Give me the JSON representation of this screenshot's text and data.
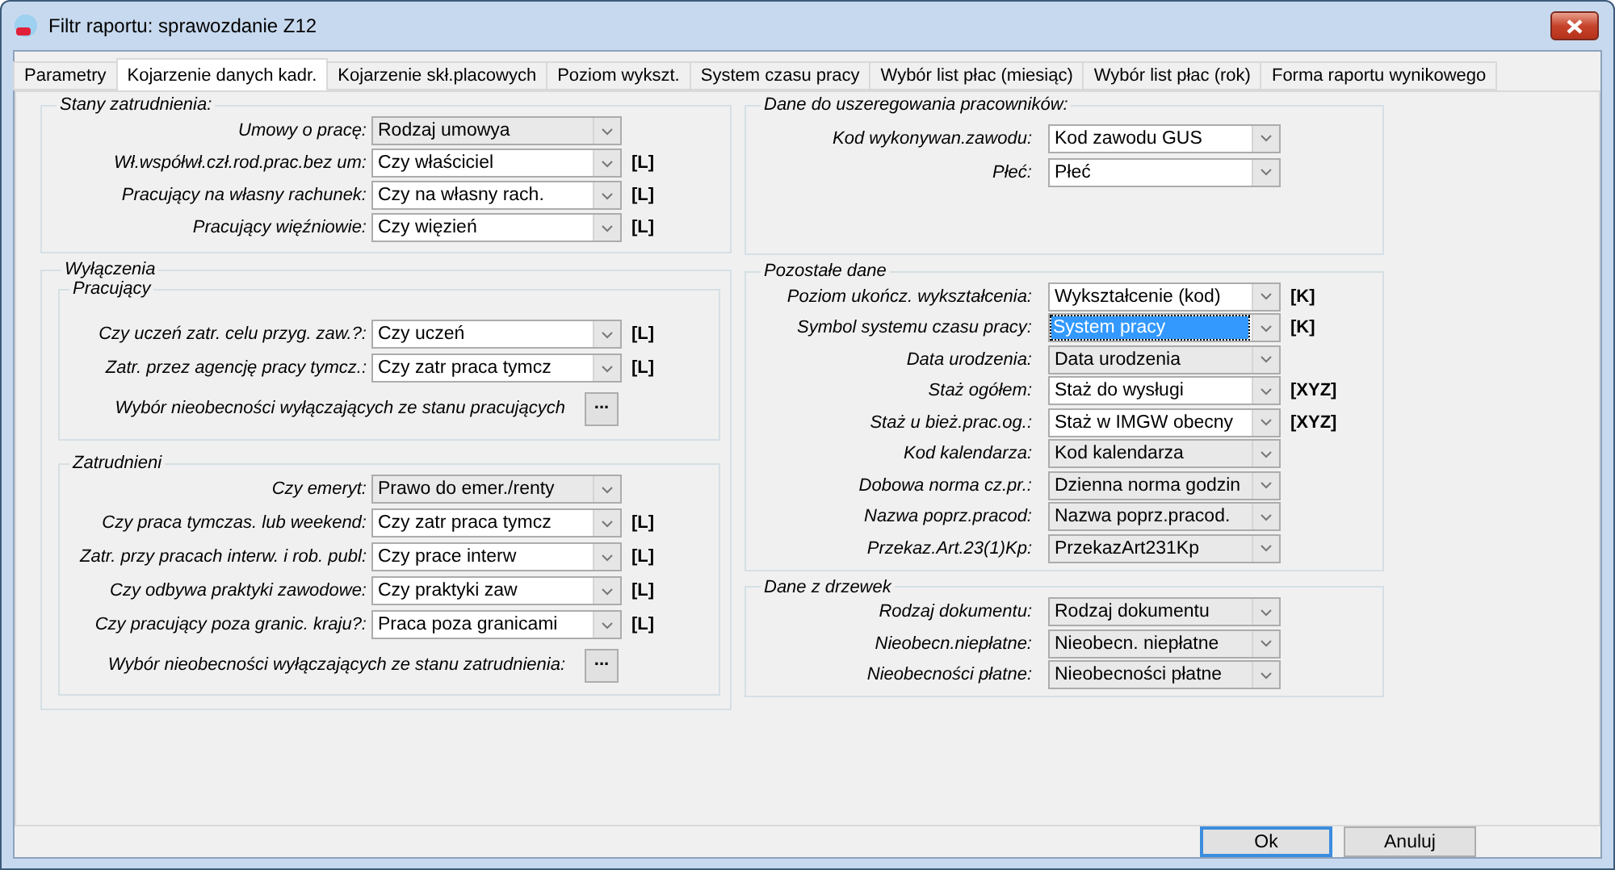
{
  "window": {
    "title": "Filtr raportu: sprawozdanie Z12"
  },
  "tabs": [
    {
      "label": "Parametry",
      "selected": false
    },
    {
      "label": "Kojarzenie danych kadr.",
      "selected": true
    },
    {
      "label": "Kojarzenie skł.placowych",
      "selected": false
    },
    {
      "label": "Poziom wykszt.",
      "selected": false
    },
    {
      "label": "System czasu pracy",
      "selected": false
    },
    {
      "label": "Wybór list płac (miesiąc)",
      "selected": false
    },
    {
      "label": "Wybór list płac (rok)",
      "selected": false
    },
    {
      "label": "Forma raportu wynikowego",
      "selected": false
    }
  ],
  "left_groups": [
    {
      "title": "Stany zatrudnienia:",
      "rows": [
        {
          "kind": "combo",
          "label": "Umowy o pracę:",
          "value": "Rodzaj umowya",
          "disabled": true
        },
        {
          "kind": "combo",
          "label": "Wł.współwł.czł.rod.prac.bez um:",
          "value": "Czy właściciel",
          "disabled": false,
          "tag": "[L]"
        },
        {
          "kind": "combo",
          "label": "Pracujący na własny rachunek:",
          "value": "Czy na własny rach.",
          "disabled": false,
          "tag": "[L]"
        },
        {
          "kind": "combo",
          "label": "Pracujący więźniowie:",
          "value": "Czy więzień",
          "disabled": false,
          "tag": "[L]"
        }
      ]
    },
    {
      "title": "Wyłączenia",
      "subgroups": [
        {
          "title": "Pracujący",
          "rows": [
            {
              "kind": "combo",
              "label": "Czy uczeń zatr. celu przyg. zaw.?:",
              "value": "Czy uczeń",
              "disabled": false,
              "tag": "[L]"
            },
            {
              "kind": "combo",
              "label": "Zatr. przez agencję pracy tymcz.:",
              "value": "Czy zatr praca tymcz",
              "disabled": false,
              "tag": "[L]"
            },
            {
              "kind": "button",
              "label": "Wybór nieobecności wyłączających ze stanu pracujących",
              "button": "..."
            }
          ]
        },
        {
          "title": "Zatrudnieni",
          "rows": [
            {
              "kind": "combo",
              "label": "Czy emeryt:",
              "value": "Prawo do emer./renty",
              "disabled": true
            },
            {
              "kind": "combo",
              "label": "Czy praca tymczas. lub weekend:",
              "value": "Czy zatr praca tymcz",
              "disabled": false,
              "tag": "[L]"
            },
            {
              "kind": "combo",
              "label": "Zatr. przy pracach interw. i rob. publ:",
              "value": "Czy prace interw",
              "disabled": false,
              "tag": "[L]"
            },
            {
              "kind": "combo",
              "label": "Czy odbywa praktyki zawodowe:",
              "value": "Czy praktyki zaw",
              "disabled": false,
              "tag": "[L]"
            },
            {
              "kind": "combo",
              "label": "Czy pracujący poza granic. kraju?:",
              "value": "Praca poza granicami",
              "disabled": false,
              "tag": "[L]"
            },
            {
              "kind": "button",
              "label": "Wybór nieobecności wyłączających ze stanu zatrudnienia:",
              "button": "..."
            }
          ]
        }
      ]
    }
  ],
  "right_groups": [
    {
      "title": "Dane do uszeregowania pracowników:",
      "rows": [
        {
          "kind": "combo",
          "label": "Kod wykonywan.zawodu:",
          "value": "Kod zawodu GUS",
          "disabled": false
        },
        {
          "kind": "combo",
          "label": "Płeć:",
          "value": "Płeć",
          "disabled": false
        }
      ]
    },
    {
      "title": "Pozostałe dane",
      "rows": [
        {
          "kind": "combo",
          "label": "Poziom ukończ. wykształcenia:",
          "value": "Wykształcenie (kod)",
          "disabled": false,
          "tag": "[K]"
        },
        {
          "kind": "combo",
          "label": "Symbol systemu czasu pracy:",
          "value": "System pracy",
          "disabled": false,
          "focused": true,
          "tag": "[K]"
        },
        {
          "kind": "combo",
          "label": "Data urodzenia:",
          "value": "Data urodzenia",
          "disabled": true
        },
        {
          "kind": "combo",
          "label": "Staż ogółem:",
          "value": "Staż do wysługi",
          "disabled": false,
          "tag": "[XYZ]"
        },
        {
          "kind": "combo",
          "label": "Staż u bież.prac.og.:",
          "value": "Staż w IMGW obecny",
          "disabled": false,
          "tag": "[XYZ]"
        },
        {
          "kind": "combo",
          "label": "Kod kalendarza:",
          "value": "Kod kalendarza",
          "disabled": true
        },
        {
          "kind": "combo",
          "label": "Dobowa norma cz.pr.:",
          "value": "Dzienna norma godzin",
          "disabled": true
        },
        {
          "kind": "combo",
          "label": "Nazwa poprz.pracod:",
          "value": "Nazwa poprz.pracod.",
          "disabled": true
        },
        {
          "kind": "combo",
          "label": "Przekaz.Art.23(1)Kp:",
          "value": "PrzekazArt231Kp",
          "disabled": true
        }
      ]
    },
    {
      "title": "Dane z drzewek",
      "rows": [
        {
          "kind": "combo",
          "label": "Rodzaj dokumentu:",
          "value": "Rodzaj dokumentu",
          "disabled": true
        },
        {
          "kind": "combo",
          "label": "Nieobecn.niepłatne:",
          "value": "Nieobecn. niepłatne",
          "disabled": true
        },
        {
          "kind": "combo",
          "label": "Nieobecności płatne:",
          "value": "Nieobecności płatne",
          "disabled": true
        }
      ]
    }
  ],
  "buttons": [
    {
      "label": "Ok",
      "default": true
    },
    {
      "label": "Anuluj",
      "default": false
    }
  ]
}
